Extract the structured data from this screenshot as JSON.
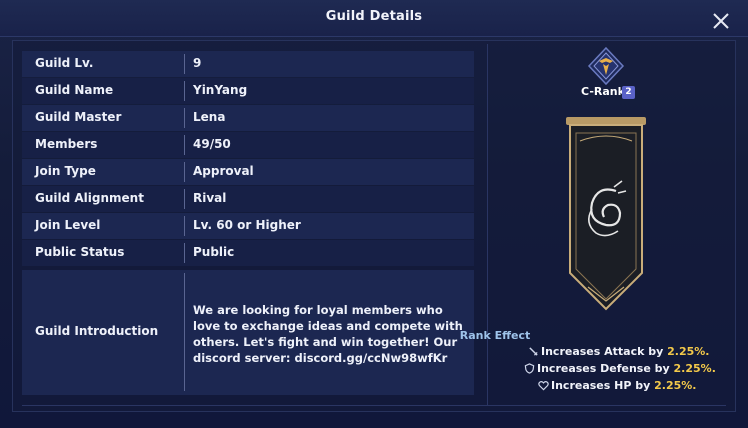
{
  "window": {
    "title": "Guild Details"
  },
  "guild_info": [
    {
      "label": "Guild Lv.",
      "value": "9"
    },
    {
      "label": "Guild Name",
      "value": "YinYang"
    },
    {
      "label": "Guild Master",
      "value": "Lena"
    },
    {
      "label": "Members",
      "value": "49/50"
    },
    {
      "label": "Join Type",
      "value": "Approval"
    },
    {
      "label": "Guild Alignment",
      "value": "Rival"
    },
    {
      "label": "Join Level",
      "value": "Lv. 60 or Higher"
    },
    {
      "label": "Public Status",
      "value": "Public"
    }
  ],
  "introduction": {
    "label": "Guild Introduction",
    "text": "We are looking for loyal members who love to exchange ideas and compete with others. Let's fight and win together! Our discord server: discord.gg/ccNw98wfKr"
  },
  "rank": {
    "label": "C-Rank",
    "level": "2",
    "effect_title": "Rank Effect",
    "effects": [
      {
        "icon": "sword-icon",
        "text": "Increases Attack by ",
        "value": "2.25%."
      },
      {
        "icon": "shield-icon",
        "text": "Increases Defense by ",
        "value": "2.25%."
      },
      {
        "icon": "heart-icon",
        "text": "Increases HP by ",
        "value": "2.25%."
      }
    ]
  },
  "colors": {
    "accent_gold": "#f3c94a",
    "effect_title": "#9ec3ea",
    "rank_badge": "#5a62c8"
  }
}
